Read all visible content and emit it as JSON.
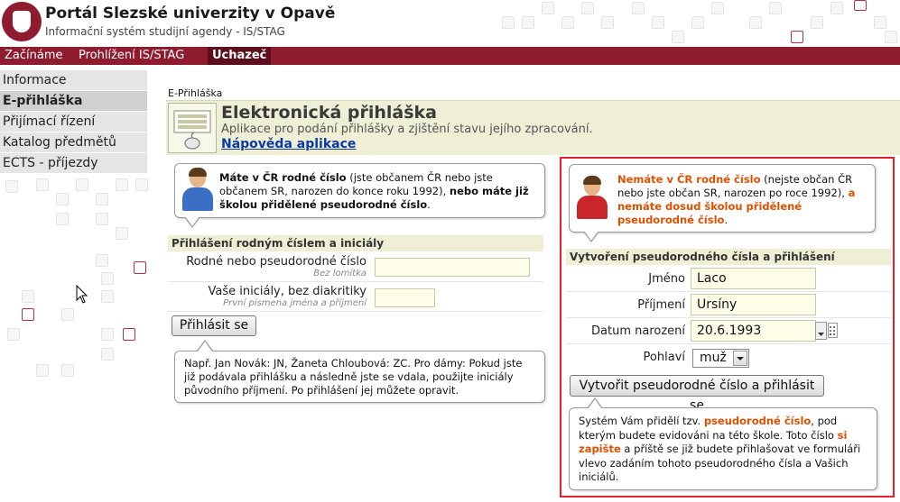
{
  "header": {
    "title": "Portál Slezské univerzity v Opavě",
    "subtitle": "Informační systém studijní agendy - IS/STAG"
  },
  "nav": {
    "items": [
      "Začínáme",
      "Prohlížení IS/STAG",
      "Uchazeč"
    ],
    "active": "Uchazeč"
  },
  "sidebar": {
    "items": [
      "Informace",
      "E-přihláška",
      "Přijímací řízení",
      "Katalog předmětů",
      "ECTS - příjezdy"
    ],
    "active": "E-přihláška"
  },
  "breadcrumb": "E-Přihláška",
  "app": {
    "title": "Elektronická přihláška",
    "description": "Aplikace pro podání přihlášky a zjištění stavu jejího zpracování.",
    "help_link": "Nápověda aplikace"
  },
  "left": {
    "bubble": {
      "strong1": "Máte v ČR rodné číslo",
      "text1": " (jste občanem ČR nebo jste občanem SR, narozen do konce roku 1992), ",
      "strong2": "nebo máte již školou přidělené pseudorodné číslo",
      "text2": "."
    },
    "section_title": "Přihlášení rodným číslem a iniciály",
    "fields": {
      "rc_label": "Rodné nebo pseudorodné číslo",
      "rc_hint": "Bez lomítka",
      "rc_value": "",
      "initials_label": "Vaše iniciály, bez diakritiky",
      "initials_hint": "První písmena jména a příjmení",
      "initials_value": ""
    },
    "login_button": "Přihlásit se",
    "note": "Např. Jan Novák: JN, Žaneta Chloubová: ZC. Pro dámy: Pokud jste již podávala přihlášku a následně jste se vdala, použijte iniciály původního příjmení. Po přihlášení jej můžete opravit."
  },
  "right": {
    "bubble": {
      "strong1": "Nemáte v ČR rodné číslo",
      "text1": " (nejste občan ČR nebo jste občan SR, narozen po roce 1992), ",
      "strong2": "a nemáte dosud školou přidělené pseudorodné číslo",
      "text2": "."
    },
    "section_title": "Vytvoření pseudorodného čísla a přihlášení",
    "fields": {
      "name_label": "Jméno",
      "name_value": "Laco",
      "surname_label": "Příjmení",
      "surname_value": "Ursíny",
      "birth_label": "Datum narození",
      "birth_value": "20.6.1993",
      "gender_label": "Pohlaví",
      "gender_value": "muž"
    },
    "create_button": "Vytvořit pseudorodné číslo a přihlásit se",
    "note": {
      "t1": "Systém Vám přidělí tzv. ",
      "s1": "pseudorodné číslo",
      "t2": ", pod kterým budete evidováni na této škole. Toto číslo ",
      "s2": "si zapište",
      "t3": " a příště se již budete přihlašovat ve formuláři vlevo zadáním tohoto pseudorodného čísla a Vašich iniciálů."
    }
  },
  "colors": {
    "brand": "#8e1b2e",
    "brand_dark": "#5d0f1e",
    "highlight_orange": "#e05000",
    "frame_red": "#e8202a",
    "link_blue": "#0b3aa8"
  }
}
